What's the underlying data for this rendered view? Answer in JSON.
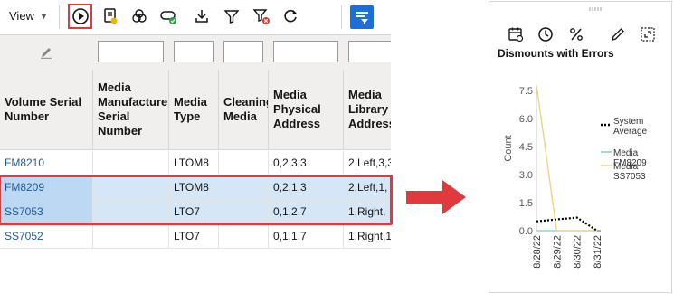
{
  "toolbar": {
    "view_label": "View",
    "icons": [
      "run-icon",
      "media-icon",
      "group-icon",
      "toggle-icon",
      "download-icon",
      "filter-icon",
      "clear-filter-icon",
      "refresh-icon",
      "column-filter-icon"
    ]
  },
  "table": {
    "columns": [
      {
        "label": "Volume Serial\nNumber"
      },
      {
        "label": "Media\nManufacturer\nSerial\nNumber"
      },
      {
        "label": "Media\nType"
      },
      {
        "label": "Cleaning\nMedia"
      },
      {
        "label": "Media\nPhysical\nAddress"
      },
      {
        "label": "Media\nLibrary\nAddress"
      }
    ],
    "rows": [
      {
        "vsn": "FM8210",
        "mfr": "",
        "type": "LTOM8",
        "cleaning": "",
        "phys": "0,2,3,3",
        "lib": "2,Left,3,3",
        "selected": false
      },
      {
        "vsn": "FM8209",
        "mfr": "",
        "type": "LTOM8",
        "cleaning": "",
        "phys": "0,2,1,3",
        "lib": "2,Left,1,",
        "selected": true
      },
      {
        "vsn": "SS7053",
        "mfr": "",
        "type": "LTO7",
        "cleaning": "",
        "phys": "0,1,2,7",
        "lib": "1,Right,",
        "selected": true
      },
      {
        "vsn": "SS7052",
        "mfr": "",
        "type": "LTO7",
        "cleaning": "",
        "phys": "0,1,1,7",
        "lib": "1,Right,1",
        "selected": false
      }
    ]
  },
  "chart_panel": {
    "icons": [
      "calendar-icon",
      "clock-icon",
      "percent-icon",
      "edit-icon",
      "expand-icon"
    ]
  },
  "colors": {
    "accent_red": "#e0393e",
    "toolbar_blue": "#1c6fd6",
    "link_blue": "#1f5a9c",
    "selected_row": "#d5e6f7",
    "series_avg": "#000000",
    "series_fm8209": "#7dd3c0",
    "series_ss7053": "#e8d47a"
  },
  "chart_data": {
    "type": "line",
    "title": "Dismounts with Errors",
    "ylabel": "Count",
    "xlabel": "",
    "categories": [
      "8/28/22",
      "8/29/22",
      "8/30/22",
      "8/31/22"
    ],
    "ylim": [
      0,
      7.5
    ],
    "yticks": [
      "0.0",
      "1.5",
      "3.0",
      "4.5",
      "6.0",
      "7.5"
    ],
    "series": [
      {
        "name": "System Average",
        "style": "dotted",
        "values": [
          0.5,
          0.6,
          0.7,
          0.0
        ]
      },
      {
        "name": "Media FM8209",
        "style": "solid",
        "values": [
          0,
          0,
          0,
          0
        ]
      },
      {
        "name": "Media SS7053",
        "style": "solid",
        "values": [
          7.8,
          0,
          0,
          0
        ]
      }
    ],
    "legend_position": "right",
    "legend": [
      "System\nAverage",
      "Media\nFM8209",
      "Media\nSS7053"
    ]
  }
}
